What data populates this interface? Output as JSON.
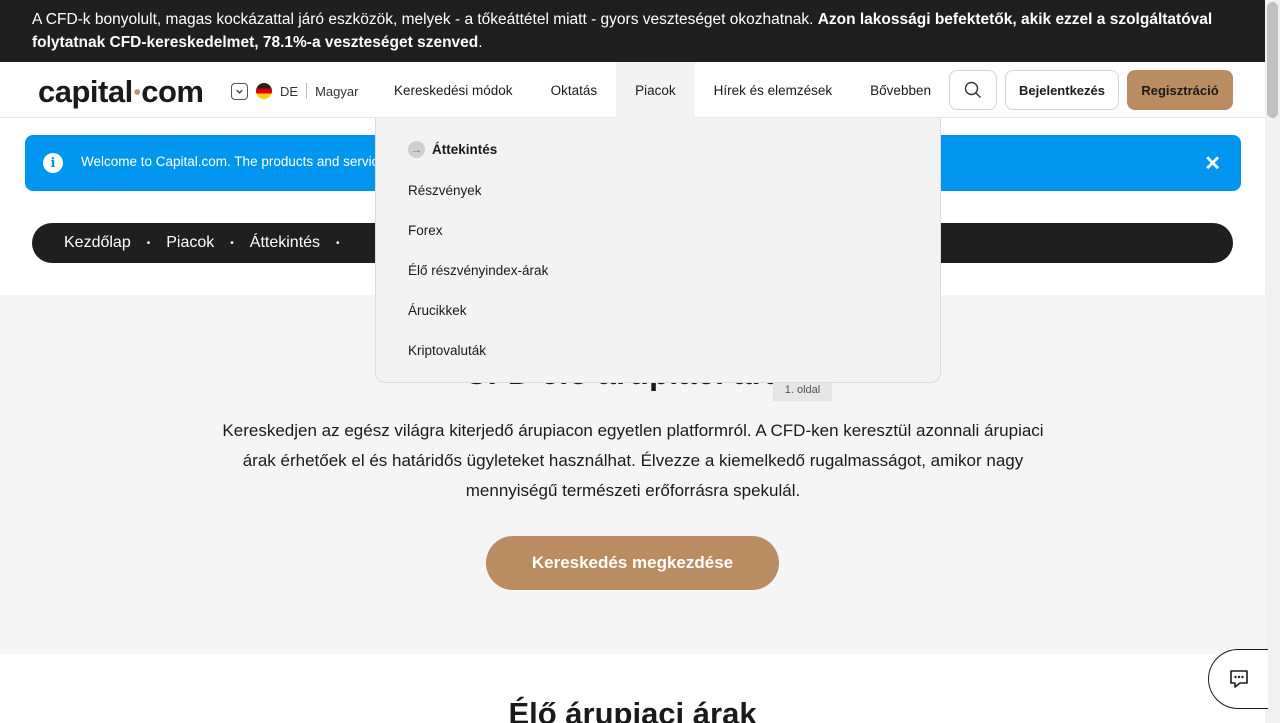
{
  "risk_banner": {
    "text_normal": "A CFD-k bonyolult, magas kockázattal járó eszközök, melyek - a tőkeáttétel miatt - gyors veszteséget okozhatnak. ",
    "text_bold": "Azon lakossági befektetők, akik ezzel a szolgáltatóval folytatnak CFD-kereskedelmet, 78.1%-a veszteséget szenved",
    "text_end": "."
  },
  "header": {
    "logo_left": "capital",
    "logo_dot": "•",
    "logo_right": "com",
    "language_code": "DE",
    "language_name": "Magyar",
    "nav": [
      {
        "label": "Kereskedési módok"
      },
      {
        "label": "Oktatás"
      },
      {
        "label": "Piacok"
      },
      {
        "label": "Hírek és elemzések"
      },
      {
        "label": "Bővebben"
      }
    ],
    "login_label": "Bejelentkezés",
    "register_label": "Regisztráció"
  },
  "dropdown": {
    "items": [
      {
        "label": "Áttekintés"
      },
      {
        "label": "Részvények"
      },
      {
        "label": "Forex"
      },
      {
        "label": "Élő részvényindex-árak"
      },
      {
        "label": "Árucikkek"
      },
      {
        "label": "Kriptovaluták"
      }
    ]
  },
  "info_bar": {
    "text": "Welcome to Capital.com. The products and servic"
  },
  "breadcrumb": {
    "items": [
      {
        "label": "Kezdőlap"
      },
      {
        "label": "Piacok"
      },
      {
        "label": "Áttekintés"
      }
    ],
    "separator": "•"
  },
  "hero": {
    "title": "CFD élő árupiaci árak",
    "page_badge": "1. oldal",
    "description": "Kereskedjen az egész világra kiterjedő árupiacon egyetlen platformról. A CFD-ken keresztül azonnali árupiaci árak érhetőek el és határidős ügyleteket használhat. Élvezze a kiemelkedő rugalmasságot, amikor nagy mennyiségű természeti erőforrásra spekulál.",
    "cta_label": "Kereskedés megkezdése"
  },
  "section": {
    "title": "Élő árupiaci árak"
  },
  "colors": {
    "accent": "#b98c62",
    "info_blue": "#0096f0",
    "dark": "#1f1f1f"
  }
}
